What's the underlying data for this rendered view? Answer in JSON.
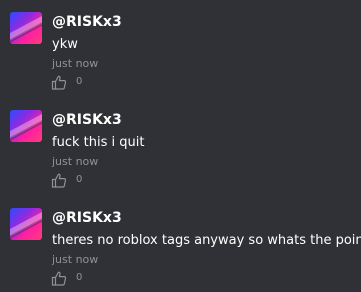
{
  "posts": [
    {
      "username": "@RISKx3",
      "text": "ykw",
      "timestamp": "just now",
      "like_count": "0"
    },
    {
      "username": "@RISKx3",
      "text": "fuck this i quit",
      "timestamp": "just now",
      "like_count": "0"
    },
    {
      "username": "@RISKx3",
      "text": "theres no roblox tags anyway so whats the point",
      "timestamp": "just now",
      "like_count": "0"
    }
  ],
  "icons": {
    "like": "thumbs-up-icon"
  },
  "colors": {
    "background": "#2f3136",
    "text": "#ffffff",
    "muted": "#8e9297"
  }
}
